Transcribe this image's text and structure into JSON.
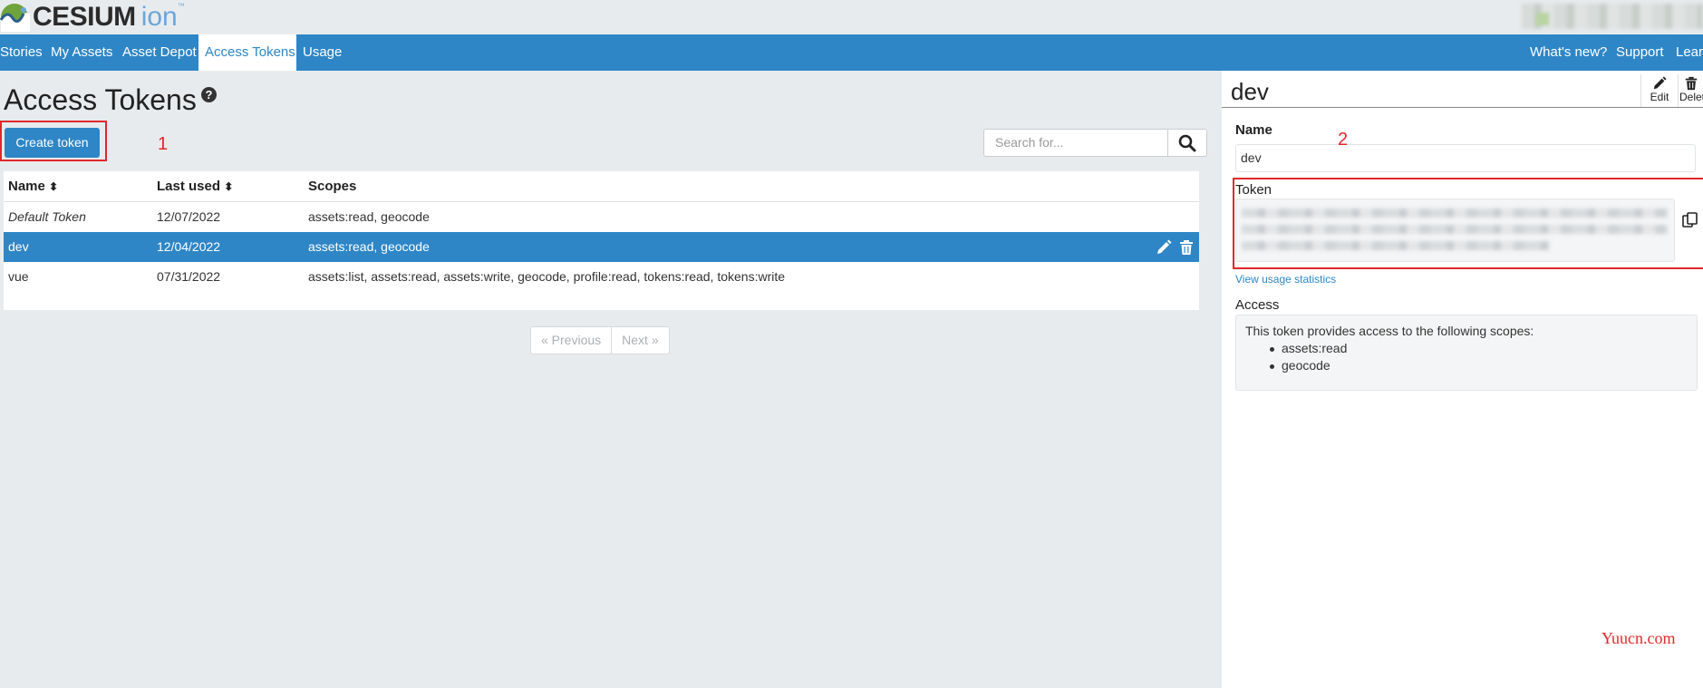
{
  "brand": {
    "name": "CESIUM",
    "product": "ion",
    "tm": "™"
  },
  "nav": {
    "items": [
      "Stories",
      "My Assets",
      "Asset Depot",
      "Access Tokens",
      "Usage"
    ],
    "active": "Access Tokens",
    "right_items": [
      "What's new?",
      "Support",
      "Learn"
    ]
  },
  "page": {
    "title": "Access Tokens",
    "help_glyph": "?",
    "create_button": "Create token",
    "search_placeholder": "Search for..."
  },
  "table": {
    "columns": [
      "Name",
      "Last used",
      "Scopes"
    ],
    "sort_glyph": "⬍",
    "rows": [
      {
        "name": "Default Token",
        "last_used": "12/07/2022",
        "scopes": "assets:read, geocode",
        "italic": true
      },
      {
        "name": "dev",
        "last_used": "12/04/2022",
        "scopes": "assets:read, geocode",
        "selected": true
      },
      {
        "name": "vue",
        "last_used": "07/31/2022",
        "scopes": "assets:list, assets:read, assets:write, geocode, profile:read, tokens:read, tokens:write"
      }
    ]
  },
  "pager": {
    "previous": "« Previous",
    "next": "Next »"
  },
  "detail": {
    "title": "dev",
    "edit_label": "Edit",
    "delete_label": "Delete",
    "name_label": "Name",
    "name_value": "dev",
    "token_label": "Token",
    "usage_link": "View usage statistics",
    "access_label": "Access",
    "access_text": "This token provides access to the following scopes:",
    "scopes": [
      "assets:read",
      "geocode"
    ]
  },
  "annotations": {
    "one": "1",
    "two": "2"
  },
  "watermark": "Yuucn.com",
  "colors": {
    "primary": "#2e86c6",
    "annotation": "#e0282c",
    "background": "#e8ebee"
  }
}
